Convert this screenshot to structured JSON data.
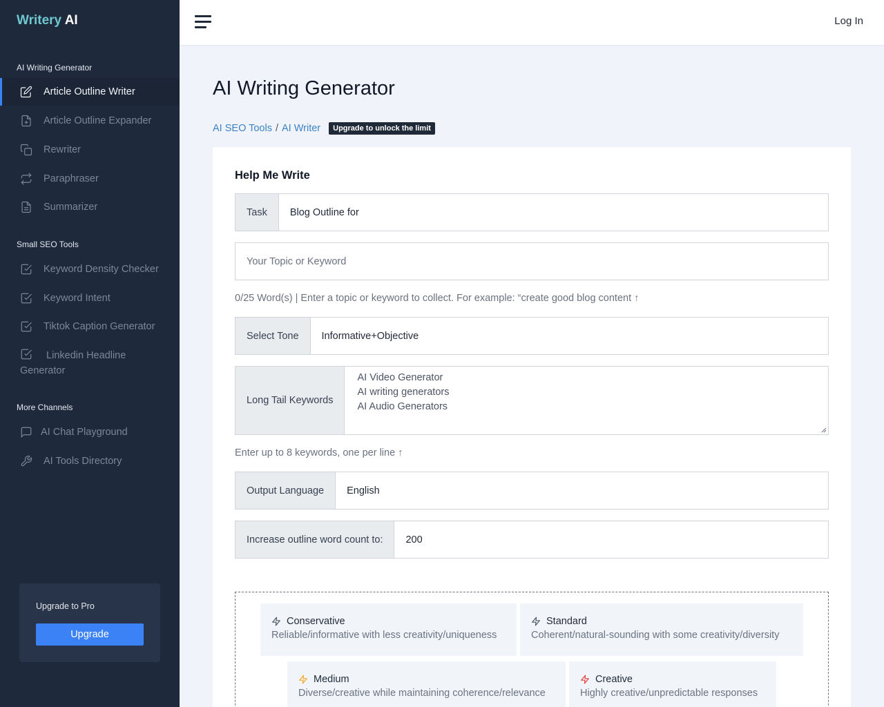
{
  "brand": {
    "part1": "Writery",
    "part2": "AI"
  },
  "sidebar": {
    "sections": [
      {
        "title": "AI Writing Generator"
      },
      {
        "title": "Small SEO Tools"
      },
      {
        "title": "More Channels"
      }
    ],
    "items": [
      {
        "label": "Article Outline Writer",
        "icon": "edit-icon",
        "active": true
      },
      {
        "label": "Article Outline Expander",
        "icon": "file-plus-icon"
      },
      {
        "label": "Rewriter",
        "icon": "copy-icon"
      },
      {
        "label": "Paraphraser",
        "icon": "repeat-icon"
      },
      {
        "label": "Summarizer",
        "icon": "file-text-icon"
      },
      {
        "label": "Keyword Density Checker",
        "icon": "check-square-icon"
      },
      {
        "label": "Keyword Intent",
        "icon": "check-square-icon"
      },
      {
        "label": "Tiktok Caption Generator",
        "icon": "check-square-icon"
      },
      {
        "label": "Linkedin Headline Generator",
        "icon": "check-square-icon"
      },
      {
        "label": "AI Chat Playground",
        "icon": "message-square-icon"
      },
      {
        "label": "AI Tools Directory",
        "icon": "wrench-icon"
      }
    ],
    "upgrade": {
      "title": "Upgrade to Pro",
      "button": "Upgrade"
    }
  },
  "topbar": {
    "login": "Log In",
    "menu_icon": "hamburger-icon"
  },
  "page": {
    "title": "AI Writing Generator",
    "breadcrumb": {
      "link1": "AI SEO Tools",
      "separator": "/",
      "link2": "AI Writer"
    },
    "badge": "Upgrade to unlock the limit"
  },
  "form": {
    "title": "Help Me Write",
    "task": {
      "label": "Task",
      "value": "Blog Outline for"
    },
    "topic": {
      "placeholder": "Your Topic or Keyword"
    },
    "topic_help": "0/25 Word(s) | Enter a topic or keyword to collect. For example: “create good blog content ↑",
    "tone": {
      "label": "Select Tone",
      "value": "Informative+Objective"
    },
    "keywords": {
      "label": "Long Tail Keywords",
      "lines": [
        "AI Video Generator",
        "AI writing generators",
        "AI Audio Generators"
      ]
    },
    "keywords_help": "Enter up to 8 keywords, one per line ↑",
    "language": {
      "label": "Output Language",
      "value": "English"
    },
    "word_count": {
      "label": "Increase outline word count to:",
      "value": "200"
    }
  },
  "creativity": [
    {
      "name": "Conservative",
      "desc": "Reliable/informative with less creativity/uniqueness",
      "icon": "bolt-outline-icon"
    },
    {
      "name": "Standard",
      "desc": "Coherent/natural-sounding with some creativity/diversity",
      "icon": "bolt-outline-icon"
    },
    {
      "name": "Medium",
      "desc": "Diverse/creative while maintaining coherence/relevance",
      "icon": "bolt-yellow-icon",
      "color": "#f5a623"
    },
    {
      "name": "Creative",
      "desc": "Highly creative/unpredictable responses",
      "icon": "bolt-red-icon",
      "color": "#e53935"
    }
  ],
  "colors": {
    "sidebar_bg": "#1e293b",
    "accent": "#3b82f6",
    "brand": "#6fc7cf"
  }
}
